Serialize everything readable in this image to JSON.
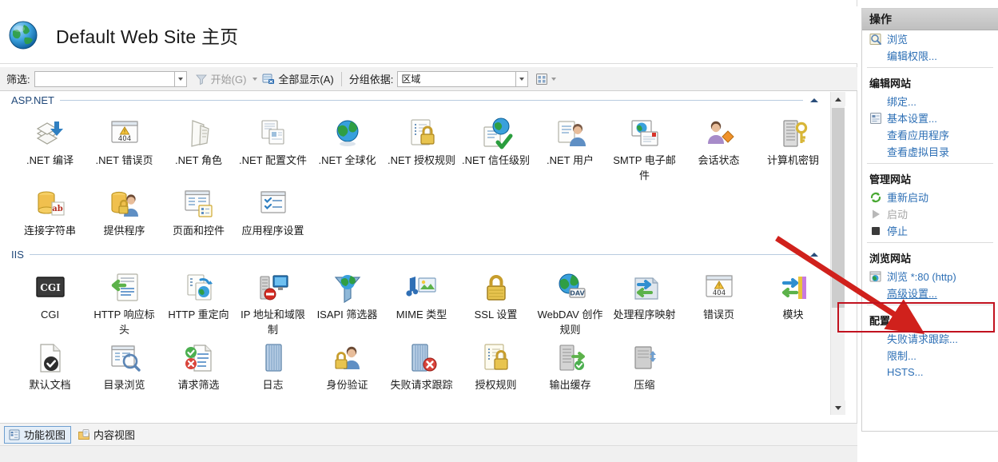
{
  "window": {
    "title": "Default Web Site 主页",
    "title_icon": "globe-icon"
  },
  "filter_bar": {
    "filter_label": "筛选:",
    "filter_value": "",
    "filter_placeholder": "",
    "go_label": "开始(G)",
    "go_icon": "funnel-icon",
    "show_all_label": "全部显示(A)",
    "show_all_icon": "show-all-icon",
    "group_by_label": "分组依据:",
    "group_by_value": "区域",
    "view_icon": "view-mode-icon"
  },
  "groups": [
    {
      "name": "ASP.NET",
      "collapse_icon": "chevron-up-icon",
      "items": [
        {
          "label": ".NET 编译",
          "icon": "net-compilation-icon"
        },
        {
          "label": ".NET 错误页",
          "icon": "net-error-pages-icon"
        },
        {
          "label": ".NET 角色",
          "icon": "net-roles-icon"
        },
        {
          "label": ".NET 配置文件",
          "icon": "net-profile-icon"
        },
        {
          "label": ".NET 全球化",
          "icon": "net-globalization-icon"
        },
        {
          "label": ".NET 授权规则",
          "icon": "net-authorization-rules-icon"
        },
        {
          "label": ".NET 信任级别",
          "icon": "net-trust-levels-icon"
        },
        {
          "label": ".NET 用户",
          "icon": "net-users-icon"
        },
        {
          "label": "SMTP 电子邮件",
          "icon": "smtp-email-icon"
        },
        {
          "label": "会话状态",
          "icon": "session-state-icon"
        },
        {
          "label": "计算机密钥",
          "icon": "machine-key-icon"
        },
        {
          "label": "连接字符串",
          "icon": "connection-strings-icon"
        },
        {
          "label": "提供程序",
          "icon": "providers-icon"
        },
        {
          "label": "页面和控件",
          "icon": "pages-and-controls-icon"
        },
        {
          "label": "应用程序设置",
          "icon": "application-settings-icon"
        }
      ]
    },
    {
      "name": "IIS",
      "collapse_icon": "chevron-up-icon",
      "items": [
        {
          "label": "CGI",
          "icon": "cgi-icon"
        },
        {
          "label": "HTTP 响应标头",
          "icon": "http-response-headers-icon"
        },
        {
          "label": "HTTP 重定向",
          "icon": "http-redirect-icon"
        },
        {
          "label": "IP 地址和域限制",
          "icon": "ip-domain-restrictions-icon"
        },
        {
          "label": "ISAPI 筛选器",
          "icon": "isapi-filters-icon"
        },
        {
          "label": "MIME 类型",
          "icon": "mime-types-icon"
        },
        {
          "label": "SSL 设置",
          "icon": "ssl-settings-icon"
        },
        {
          "label": "WebDAV 创作规则",
          "icon": "webdav-authoring-rules-icon"
        },
        {
          "label": "处理程序映射",
          "icon": "handler-mappings-icon"
        },
        {
          "label": "错误页",
          "icon": "error-pages-icon"
        },
        {
          "label": "模块",
          "icon": "modules-icon"
        },
        {
          "label": "默认文档",
          "icon": "default-document-icon"
        },
        {
          "label": "目录浏览",
          "icon": "directory-browsing-icon"
        },
        {
          "label": "请求筛选",
          "icon": "request-filtering-icon"
        },
        {
          "label": "日志",
          "icon": "logging-icon"
        },
        {
          "label": "身份验证",
          "icon": "authentication-icon"
        },
        {
          "label": "失败请求跟踪",
          "icon": "failed-request-tracing-icon"
        },
        {
          "label": "授权规则",
          "icon": "authorization-rules-icon"
        },
        {
          "label": "输出缓存",
          "icon": "output-caching-icon"
        },
        {
          "label": "压缩",
          "icon": "compression-icon"
        }
      ]
    }
  ],
  "view_tabs": [
    {
      "label": "功能视图",
      "icon": "features-view-icon",
      "active": true
    },
    {
      "label": "内容视图",
      "icon": "content-view-icon",
      "active": false
    }
  ],
  "actions": {
    "header": "操作",
    "sections": [
      {
        "title": null,
        "items": [
          {
            "label": "浏览",
            "icon": "browse-icon",
            "state": "link"
          },
          {
            "label": "编辑权限...",
            "icon": null,
            "state": "link"
          }
        ]
      },
      {
        "title": "编辑网站",
        "items": [
          {
            "label": "绑定...",
            "icon": null,
            "state": "link"
          },
          {
            "label": "基本设置...",
            "icon": "settings-icon",
            "state": "link"
          },
          {
            "label": "查看应用程序",
            "icon": null,
            "state": "link"
          },
          {
            "label": "查看虚拟目录",
            "icon": null,
            "state": "link"
          }
        ]
      },
      {
        "title": "管理网站",
        "items": [
          {
            "label": "重新启动",
            "icon": "restart-icon",
            "state": "link"
          },
          {
            "label": "启动",
            "icon": "start-icon",
            "state": "disabled"
          },
          {
            "label": "停止",
            "icon": "stop-icon",
            "state": "link"
          }
        ]
      },
      {
        "title": "浏览网站",
        "items": [
          {
            "label": "浏览 *:80 (http)",
            "icon": "browse-site-icon",
            "state": "link"
          },
          {
            "label": "高级设置...",
            "icon": null,
            "state": "link-underline"
          }
        ]
      },
      {
        "title": "配置",
        "items": [
          {
            "label": "失败请求跟踪...",
            "icon": null,
            "state": "link"
          },
          {
            "label": "限制...",
            "icon": null,
            "state": "link"
          },
          {
            "label": "HSTS...",
            "icon": null,
            "state": "link"
          }
        ]
      }
    ]
  },
  "annotation": {
    "highlight_color": "#c1121f",
    "arrow_color": "#d0211c",
    "target_label": "浏览 *:80 (http)"
  },
  "scrollbar": {
    "up_icon": "scroll-up-icon",
    "down_icon": "scroll-down-icon",
    "thumb": "scroll-thumb"
  }
}
